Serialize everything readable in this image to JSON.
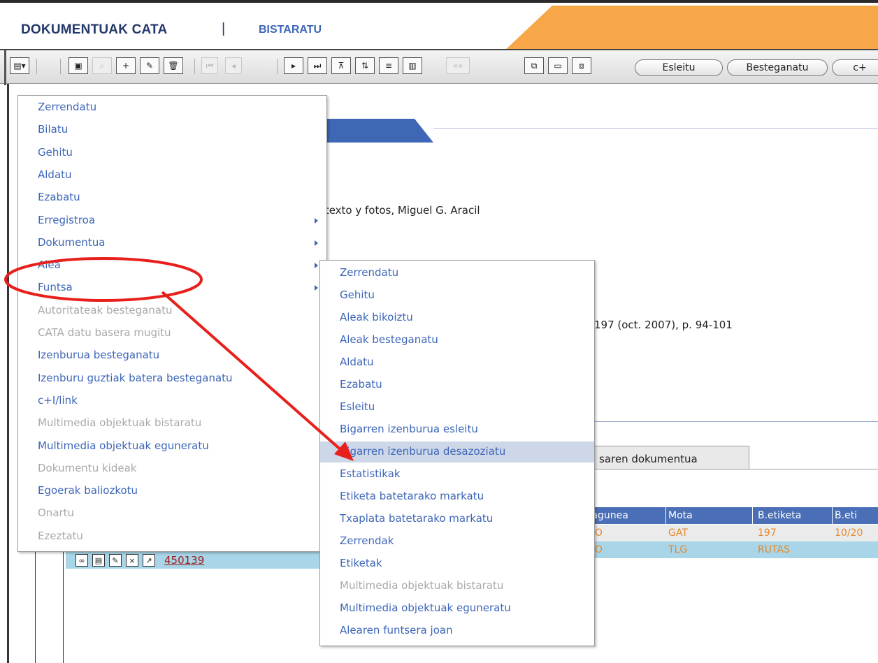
{
  "header": {
    "title": "DOKUMENTUAK CATA",
    "separator": "|",
    "view": "BISTARATU"
  },
  "toolbar": {
    "buttons": [
      {
        "name": "menu-toggle-icon",
        "glyph": "▤▾"
      },
      {
        "name": "view-icon",
        "glyph": "▣"
      },
      {
        "name": "search-icon",
        "glyph": "⌕"
      },
      {
        "name": "add-icon",
        "glyph": "+"
      },
      {
        "name": "edit-icon",
        "glyph": "✎"
      },
      {
        "name": "delete-icon",
        "glyph": "🗑"
      },
      {
        "name": "first-record-icon",
        "glyph": "⏮"
      },
      {
        "name": "previous-record-icon",
        "glyph": "◂"
      },
      {
        "name": "next-record-icon",
        "glyph": "▸"
      },
      {
        "name": "last-record-icon",
        "glyph": "⏭"
      },
      {
        "name": "filter-icon",
        "glyph": "⊼"
      },
      {
        "name": "sort-icon",
        "glyph": "⇅"
      },
      {
        "name": "columns-icon",
        "glyph": "≡"
      },
      {
        "name": "report-icon",
        "glyph": "▥"
      },
      {
        "name": "expand-icon",
        "glyph": "«»"
      },
      {
        "name": "copy-icon",
        "glyph": "⧉"
      },
      {
        "name": "window-icon",
        "glyph": "▭"
      },
      {
        "name": "paste-icon",
        "glyph": "⧈"
      }
    ],
    "pills": [
      "Esleitu",
      "Besteganatu",
      "c+"
    ]
  },
  "content": {
    "author_line": "/ texto y fotos, Miguel G. Aracil",
    "source_line": "197 (oct. 2007), p. 94-101",
    "subtab_label": "saren dokumentua"
  },
  "results": {
    "headers": [
      "okagunea",
      "Mota",
      "B.etiketa",
      "B.eti"
    ],
    "rows": [
      [
        "GO",
        "GAT",
        "197",
        "10/20"
      ],
      [
        "GO",
        "TLG",
        "RUTAS",
        ""
      ]
    ]
  },
  "row": {
    "link": "450139",
    "icons": [
      "link-icon",
      "document-icon",
      "pencil-icon",
      "close-icon",
      "assign-icon"
    ],
    "icon_glyphs": [
      "∞",
      "▤",
      "✎",
      "×",
      "↗"
    ]
  },
  "main_menu": [
    {
      "label": "Zerrendatu",
      "enabled": true,
      "submenu": false
    },
    {
      "label": "Bilatu",
      "enabled": true,
      "submenu": false
    },
    {
      "label": "Gehitu",
      "enabled": true,
      "submenu": false
    },
    {
      "label": "Aldatu",
      "enabled": true,
      "submenu": false
    },
    {
      "label": "Ezabatu",
      "enabled": true,
      "submenu": false
    },
    {
      "label": "Erregistroa",
      "enabled": true,
      "submenu": true
    },
    {
      "label": "Dokumentua",
      "enabled": true,
      "submenu": true
    },
    {
      "label": "Alea",
      "enabled": true,
      "submenu": true
    },
    {
      "label": "Funtsa",
      "enabled": true,
      "submenu": true
    },
    {
      "label": "Autoritateak besteganatu",
      "enabled": false,
      "submenu": false
    },
    {
      "label": "CATA datu basera mugitu",
      "enabled": false,
      "submenu": false
    },
    {
      "label": "Izenburua besteganatu",
      "enabled": true,
      "submenu": false
    },
    {
      "label": "Izenburu guztiak batera besteganatu",
      "enabled": true,
      "submenu": false
    },
    {
      "label": "c+I/link",
      "enabled": true,
      "submenu": false
    },
    {
      "label": "Multimedia objektuak bistaratu",
      "enabled": false,
      "submenu": false
    },
    {
      "label": "Multimedia objektuak eguneratu",
      "enabled": true,
      "submenu": false
    },
    {
      "label": "Dokumentu kideak",
      "enabled": false,
      "submenu": false
    },
    {
      "label": "Egoerak baliozkotu",
      "enabled": true,
      "submenu": false
    },
    {
      "label": "Onartu",
      "enabled": false,
      "submenu": false
    },
    {
      "label": "Ezeztatu",
      "enabled": false,
      "submenu": false
    }
  ],
  "sub_menu": [
    {
      "label": "Zerrendatu",
      "enabled": true,
      "highlighted": false
    },
    {
      "label": "Gehitu",
      "enabled": true,
      "highlighted": false
    },
    {
      "label": "Aleak bikoiztu",
      "enabled": true,
      "highlighted": false
    },
    {
      "label": "Aleak besteganatu",
      "enabled": true,
      "highlighted": false
    },
    {
      "label": "Aldatu",
      "enabled": true,
      "highlighted": false
    },
    {
      "label": "Ezabatu",
      "enabled": true,
      "highlighted": false
    },
    {
      "label": "Esleitu",
      "enabled": true,
      "highlighted": false
    },
    {
      "label": "Bigarren izenburua esleitu",
      "enabled": true,
      "highlighted": false
    },
    {
      "label": "Bigarren izenburua desazoziatu",
      "enabled": true,
      "highlighted": true
    },
    {
      "label": "Estatistikak",
      "enabled": true,
      "highlighted": false
    },
    {
      "label": "Etiketa batetarako markatu",
      "enabled": true,
      "highlighted": false
    },
    {
      "label": "Txaplata batetarako markatu",
      "enabled": true,
      "highlighted": false
    },
    {
      "label": "Zerrendak",
      "enabled": true,
      "highlighted": false
    },
    {
      "label": "Etiketak",
      "enabled": true,
      "highlighted": false
    },
    {
      "label": "Multimedia objektuak bistaratu",
      "enabled": false,
      "highlighted": false
    },
    {
      "label": "Multimedia objektuak eguneratu",
      "enabled": true,
      "highlighted": false
    },
    {
      "label": "Alearen funtsera joan",
      "enabled": true,
      "highlighted": false
    }
  ],
  "colors": {
    "link_blue": "#3d66b8",
    "header_navy": "#24396b",
    "accent_orange": "#f7a648",
    "table_header": "#4a6fb6",
    "row_highlight": "#a8d6e8",
    "menu_highlight": "#cdd7e8",
    "annotation_red": "#e8201c",
    "disabled_grey": "#a9a9a9"
  }
}
